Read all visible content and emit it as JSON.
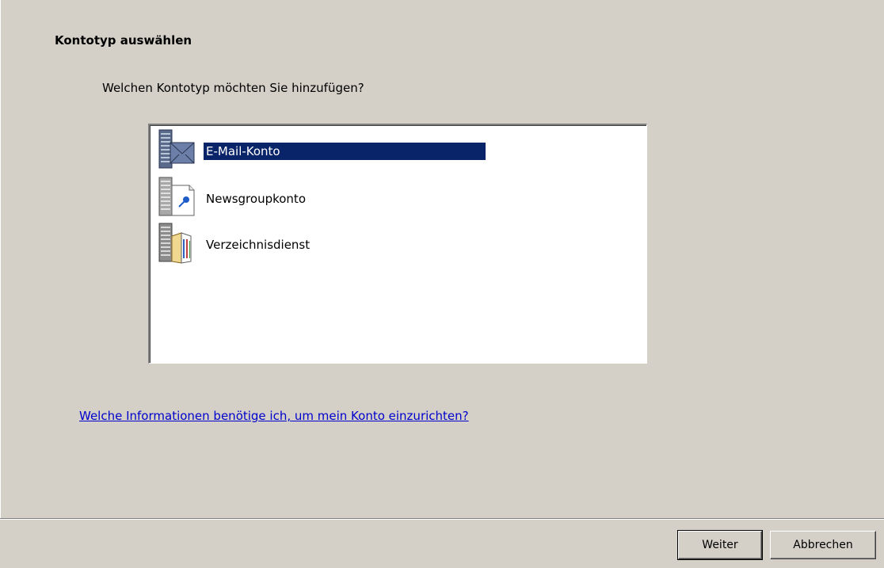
{
  "header": {
    "title": "Kontotyp auswählen",
    "question": "Welchen Kontotyp möchten Sie hinzufügen?"
  },
  "account_types": {
    "items": [
      {
        "label": "E-Mail-Konto",
        "icon": "mail-server-icon",
        "selected": true
      },
      {
        "label": "Newsgroupkonto",
        "icon": "newsgroup-icon",
        "selected": false
      },
      {
        "label": "Verzeichnisdienst",
        "icon": "directory-service-icon",
        "selected": false
      }
    ]
  },
  "help": {
    "link_text": "Welche Informationen benötige ich, um mein Konto einzurichten?"
  },
  "buttons": {
    "next_label": "Weiter",
    "cancel_label": "Abbrechen"
  },
  "colors": {
    "dialog_bg": "#d4d0c8",
    "selection_bg": "#0a246a",
    "link": "#0000cc"
  }
}
